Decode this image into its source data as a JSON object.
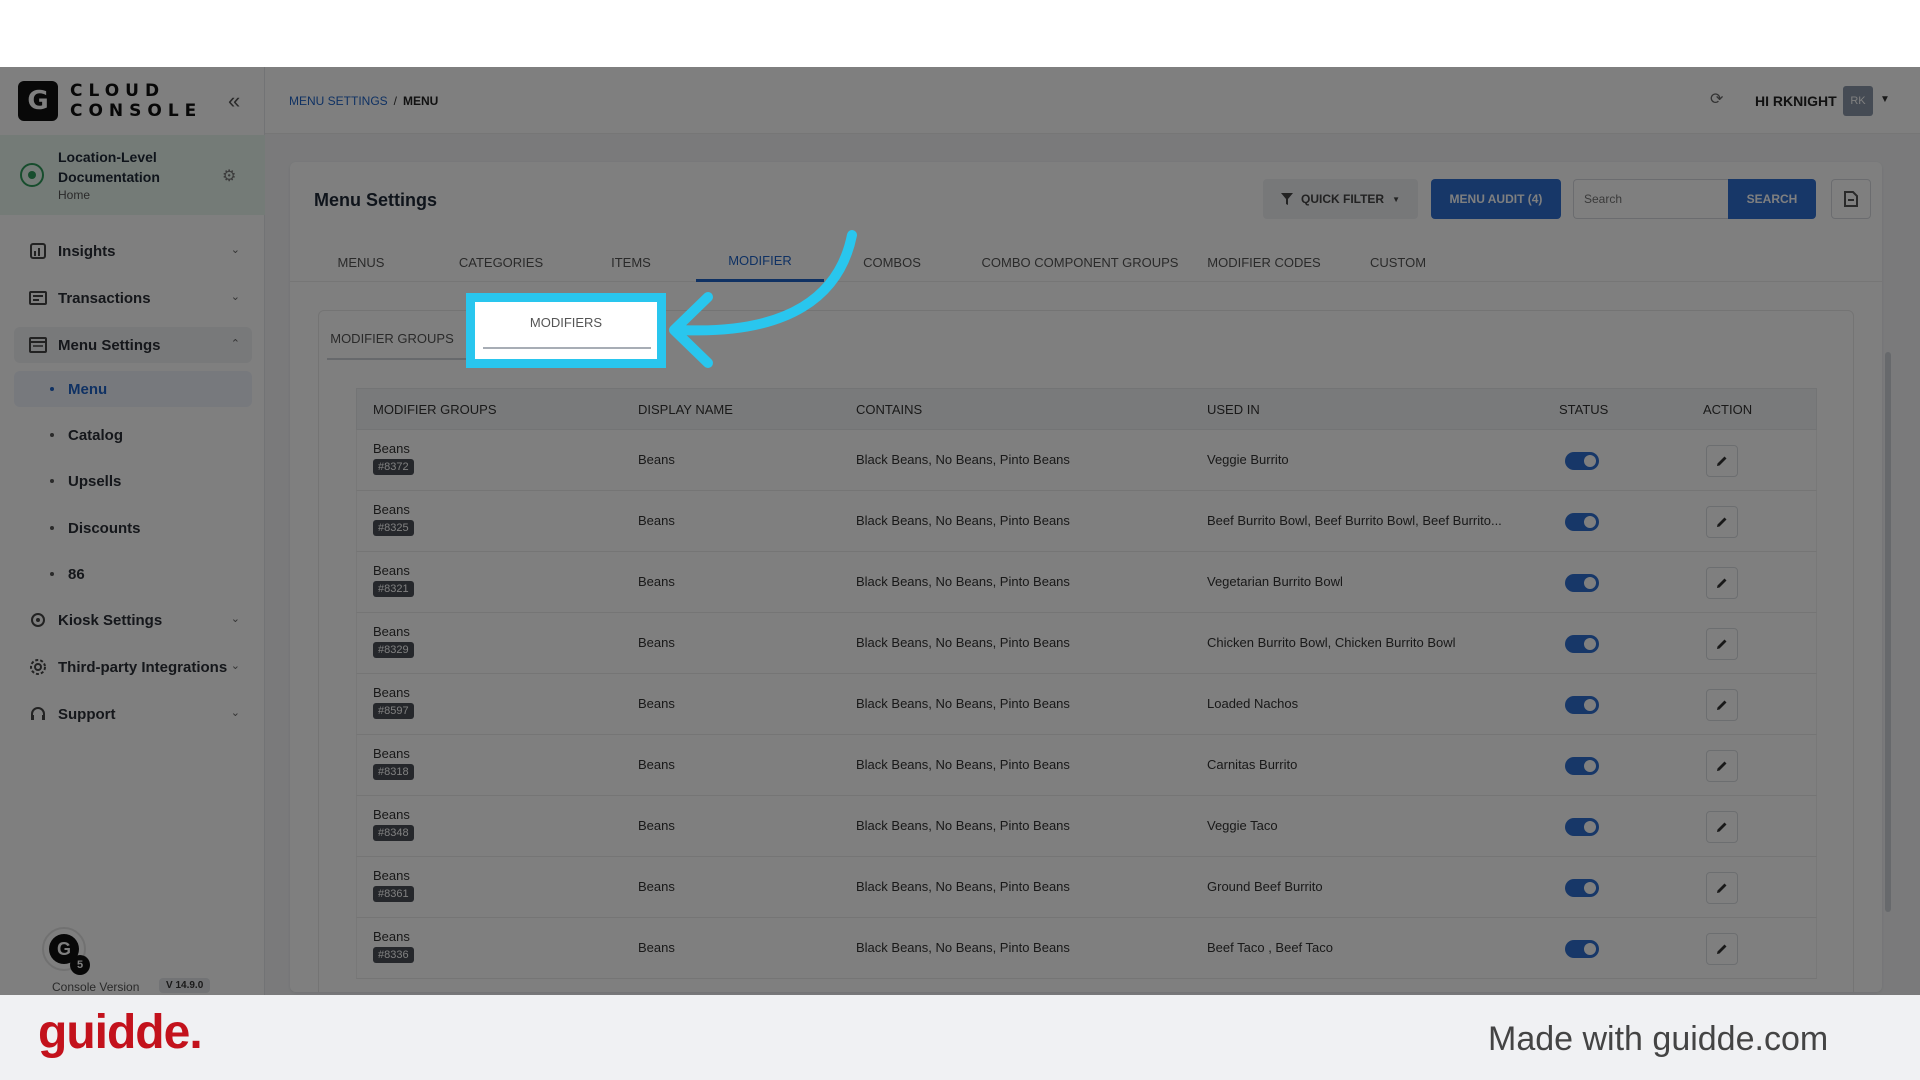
{
  "app": {
    "logo_letter": "G",
    "logo_line1": "CLOUD",
    "logo_line2": "CONSOLE"
  },
  "location": {
    "title": "Location-Level Documentation",
    "subtitle": "Home"
  },
  "sidebar": {
    "items": [
      {
        "label": "Insights",
        "icon": "insights-icon"
      },
      {
        "label": "Transactions",
        "icon": "transactions-icon"
      },
      {
        "label": "Menu Settings",
        "icon": "menu-settings-icon"
      },
      {
        "label": "Kiosk Settings",
        "icon": "gear-icon"
      },
      {
        "label": "Third-party Integrations",
        "icon": "integrations-gear-icon"
      },
      {
        "label": "Support",
        "icon": "headset-icon"
      }
    ],
    "menu_settings_sub": [
      "Menu",
      "Catalog",
      "Upsells",
      "Discounts",
      "86"
    ],
    "active_sub": "Menu",
    "avatar_letter": "G",
    "avatar_badge": "5",
    "console_version_label": "Console Version",
    "console_version": "V 14.9.0"
  },
  "header": {
    "breadcrumb_link": "MENU SETTINGS",
    "breadcrumb_sep": "/",
    "breadcrumb_current": "MENU",
    "greeting": "HI RKNIGHT",
    "avatar_initials": "RK"
  },
  "page": {
    "title": "Menu Settings",
    "quick_filter_label": "QUICK FILTER",
    "menu_audit_label": "MENU AUDIT (4)",
    "search_placeholder": "Search",
    "search_button": "SEARCH"
  },
  "tabs": [
    "MENUS",
    "CATEGORIES",
    "ITEMS",
    "MODIFIER",
    "COMBOS",
    "COMBO COMPONENT GROUPS",
    "MODIFIER CODES",
    "CUSTOM"
  ],
  "active_tab": "MODIFIER",
  "subtabs": [
    "MODIFIER GROUPS",
    "MODIFIERS"
  ],
  "highlighted_subtab": "MODIFIERS",
  "table": {
    "headers": [
      "MODIFIER GROUPS",
      "DISPLAY NAME",
      "CONTAINS",
      "USED IN",
      "STATUS",
      "ACTION"
    ],
    "rows": [
      {
        "group": "Beans",
        "id": "#8372",
        "display": "Beans",
        "contains": "Black Beans, No Beans, Pinto Beans",
        "used_in": "Veggie Burrito",
        "status": true
      },
      {
        "group": "Beans",
        "id": "#8325",
        "display": "Beans",
        "contains": "Black Beans, No Beans, Pinto Beans",
        "used_in": "Beef Burrito Bowl, Beef Burrito Bowl, Beef Burrito...",
        "status": true
      },
      {
        "group": "Beans",
        "id": "#8321",
        "display": "Beans",
        "contains": "Black Beans, No Beans, Pinto Beans",
        "used_in": "Vegetarian Burrito Bowl",
        "status": true
      },
      {
        "group": "Beans",
        "id": "#8329",
        "display": "Beans",
        "contains": "Black Beans, No Beans, Pinto Beans",
        "used_in": "Chicken Burrito Bowl, Chicken Burrito Bowl",
        "status": true
      },
      {
        "group": "Beans",
        "id": "#8597",
        "display": "Beans",
        "contains": "Black Beans, No Beans, Pinto Beans",
        "used_in": "Loaded Nachos",
        "status": true
      },
      {
        "group": "Beans",
        "id": "#8318",
        "display": "Beans",
        "contains": "Black Beans, No Beans, Pinto Beans",
        "used_in": "Carnitas Burrito",
        "status": true
      },
      {
        "group": "Beans",
        "id": "#8348",
        "display": "Beans",
        "contains": "Black Beans, No Beans, Pinto Beans",
        "used_in": "Veggie Taco",
        "status": true
      },
      {
        "group": "Beans",
        "id": "#8361",
        "display": "Beans",
        "contains": "Black Beans, No Beans, Pinto Beans",
        "used_in": "Ground Beef Burrito",
        "status": true
      },
      {
        "group": "Beans",
        "id": "#8336",
        "display": "Beans",
        "contains": "Black Beans, No Beans, Pinto Beans",
        "used_in": "Beef Taco , Beef Taco",
        "status": true
      }
    ]
  },
  "footer": {
    "brand": "guidde.",
    "made_with": "Made with guidde.com"
  },
  "colors": {
    "accent": "#2e6fd1",
    "highlight": "#29c6ee",
    "brand_red": "#c3121c"
  }
}
